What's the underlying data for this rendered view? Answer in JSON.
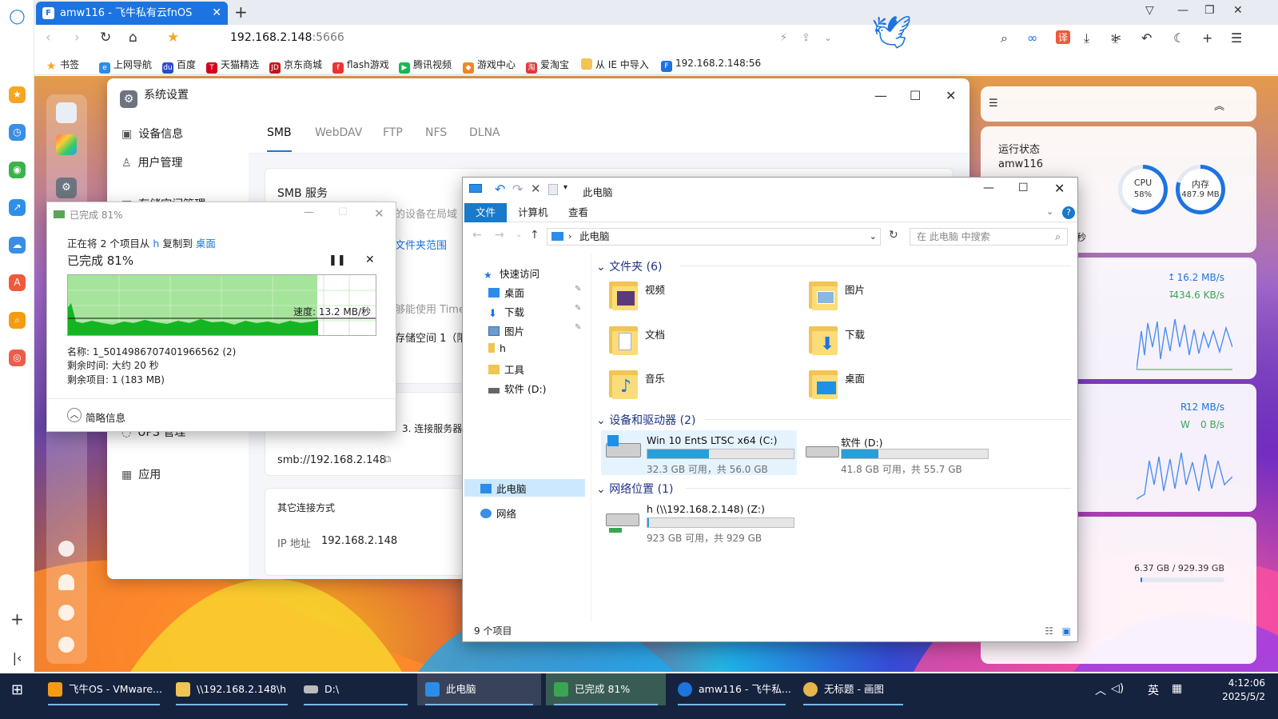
{
  "browser": {
    "tab_title": "amw116 - 飞牛私有云fnOS",
    "url_host": "192.168.2.148",
    "url_port": ":5666",
    "bookmarks": [
      "书签",
      "上网导航",
      "百度",
      "天猫精选",
      "京东商城",
      "flash游戏",
      "腾讯视频",
      "游戏中心",
      "爱淘宝",
      "从 IE 中导入",
      "192.168.2.148:56"
    ]
  },
  "sys_settings": {
    "title": "系统设置",
    "menu": [
      "设备信息",
      "用户管理",
      "存储空间管理",
      "UPS 管理",
      "应用"
    ],
    "tabs": [
      "SMB",
      "WebDAV",
      "FTP",
      "NFS",
      "DLNA"
    ],
    "smb_title": "SMB 服务",
    "smb_desc": "的设备在局域",
    "scope_link": "文件夹范围",
    "time_text": "够能使用 Time",
    "storage_text": "存储空间 1（限制",
    "connect_text": "3. 连接服务器",
    "smb_url": "smb://192.168.2.148",
    "other_title": "其它连接方式",
    "ip_label": "IP 地址",
    "ip_value": "192.168.2.148"
  },
  "widgets": {
    "status_title": "运行状态",
    "host": "amw116",
    "cpu_label": "CPU",
    "cpu_value": "58%",
    "mem_label": "内存",
    "mem_value": "487.9 MB",
    "sec_text": "秒",
    "net_up": "16.2 MB/s",
    "net_down": "434.6 KB/s",
    "disk_r_label": "R",
    "disk_r": "12 MB/s",
    "disk_w_label": "W",
    "disk_w": "0 B/s",
    "storage_usage": "6.37 GB / 929.39 GB"
  },
  "copy_dialog": {
    "title": "已完成 81%",
    "line1_pre": "正在将 2 个项目从",
    "line1_src": "h",
    "line1_mid": "复制到",
    "line1_dst": "桌面",
    "progress_text": "已完成 81%",
    "progress": 0.81,
    "speed": "速度: 13.2 MB/秒",
    "name": "名称: 1_5014986707401966562 (2)",
    "remaining_time": "剩余时间: 大约 20 秒",
    "remaining_items": "剩余项目: 1 (183 MB)",
    "less_info": "简略信息"
  },
  "explorer": {
    "title": "此电脑",
    "ribbon_tabs": [
      "文件",
      "计算机",
      "查看"
    ],
    "path": "此电脑",
    "search_placeholder": "在 此电脑 中搜索",
    "nav": {
      "quick_access": "快速访问",
      "desktop": "桌面",
      "downloads": "下载",
      "pictures": "图片",
      "h": "h",
      "tools": "工具",
      "soft_d": "软件 (D:)",
      "this_pc": "此电脑",
      "network": "网络"
    },
    "folders_header": "文件夹 (6)",
    "folders": [
      "视频",
      "图片",
      "文档",
      "下载",
      "音乐",
      "桌面"
    ],
    "devices_header": "设备和驱动器 (2)",
    "drives": [
      {
        "name": "Win 10 EntS LTSC x64 (C:)",
        "info": "32.3 GB 可用，共 56.0 GB",
        "used": 0.42
      },
      {
        "name": "软件 (D:)",
        "info": "41.8 GB 可用，共 55.7 GB",
        "used": 0.25
      }
    ],
    "net_header": "网络位置 (1)",
    "net_drive": {
      "name": "h (\\\\192.168.2.148) (Z:)",
      "info": "923 GB 可用，共 929 GB",
      "used": 0.01
    },
    "status": "9 个项目"
  },
  "taskbar": {
    "tasks": [
      "飞牛OS - VMware...",
      "\\\\192.168.2.148\\h",
      "D:\\",
      "此电脑",
      "已完成 81%",
      "amw116 - 飞牛私...",
      "无标题 - 画图"
    ],
    "ime": "英",
    "time": "4:12:06",
    "date": "2025/5/2"
  }
}
